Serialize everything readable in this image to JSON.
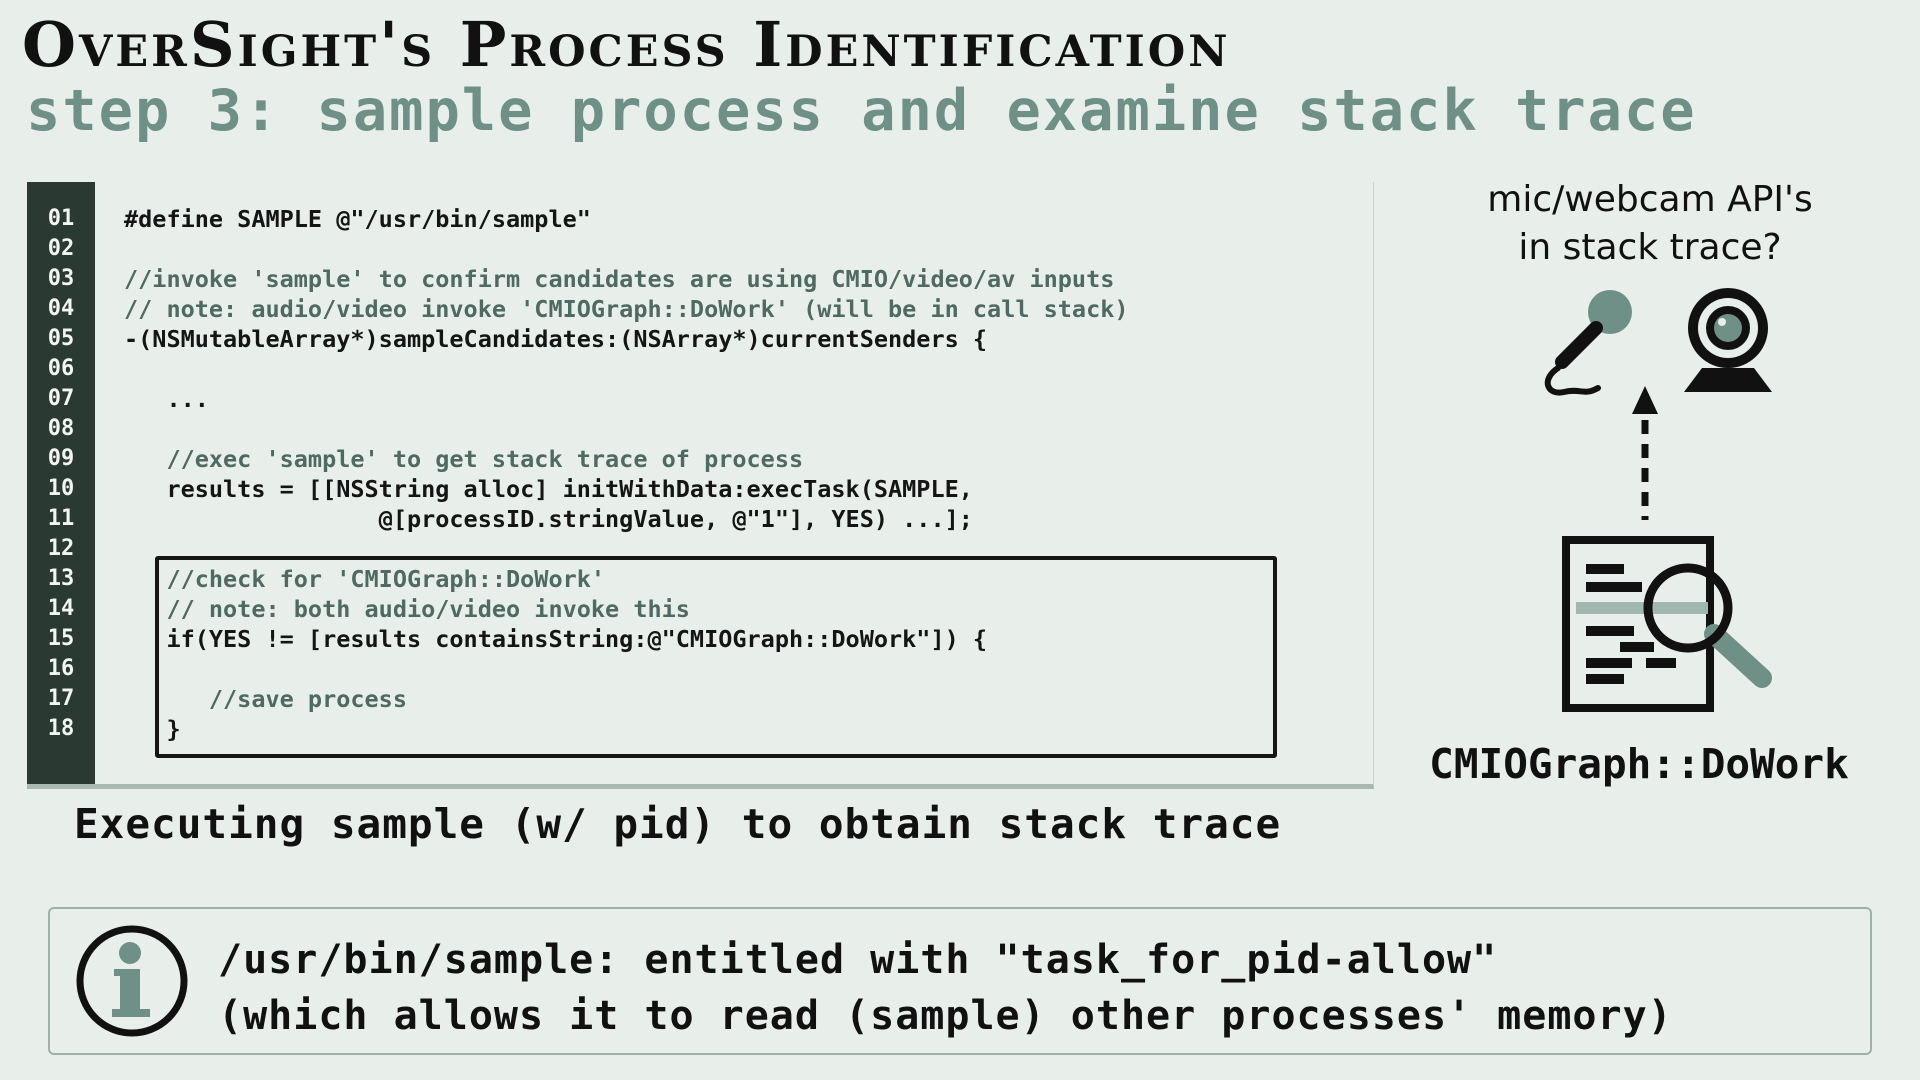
{
  "header": {
    "title": "OverSight's Process Identification",
    "subtitle": "step 3: sample process and examine stack trace"
  },
  "code": {
    "lines": [
      {
        "num": "01",
        "text": "#define SAMPLE @\"/usr/bin/sample\"",
        "kind": "code"
      },
      {
        "num": "02",
        "text": "",
        "kind": "code"
      },
      {
        "num": "03",
        "text": "//invoke 'sample' to confirm candidates are using CMIO/video/av inputs",
        "kind": "comment"
      },
      {
        "num": "04",
        "text": "// note: audio/video invoke 'CMIOGraph::DoWork' (will be in call stack)",
        "kind": "comment"
      },
      {
        "num": "05",
        "text": "-(NSMutableArray*)sampleCandidates:(NSArray*)currentSenders {",
        "kind": "code"
      },
      {
        "num": "06",
        "text": "",
        "kind": "code"
      },
      {
        "num": "07",
        "text": "   ...",
        "kind": "code"
      },
      {
        "num": "08",
        "text": "",
        "kind": "code"
      },
      {
        "num": "09",
        "text": "   //exec 'sample' to get stack trace of process",
        "kind": "comment"
      },
      {
        "num": "10",
        "text": "   results = [[NSString alloc] initWithData:execTask(SAMPLE,",
        "kind": "code"
      },
      {
        "num": "11",
        "text": "                  @[processID.stringValue, @\"1\"], YES) ...];",
        "kind": "code"
      },
      {
        "num": "12",
        "text": "",
        "kind": "code"
      },
      {
        "num": "13",
        "text": "   //check for 'CMIOGraph::DoWork'",
        "kind": "comment"
      },
      {
        "num": "14",
        "text": "   // note: both audio/video invoke this",
        "kind": "comment"
      },
      {
        "num": "15",
        "text": "   if(YES != [results containsString:@\"CMIOGraph::DoWork\"]) {",
        "kind": "code"
      },
      {
        "num": "16",
        "text": "",
        "kind": "code"
      },
      {
        "num": "17",
        "text": "      //save process",
        "kind": "comment"
      },
      {
        "num": "18",
        "text": "   }",
        "kind": "code"
      }
    ],
    "caption": "Executing sample (w/ pid) to obtain stack trace"
  },
  "diagram": {
    "question_line1": "mic/webcam API's",
    "question_line2": "in stack trace?",
    "label": "CMIOGraph::DoWork",
    "icons": [
      "microphone-icon",
      "webcam-icon",
      "up-arrow-icon",
      "document-search-icon"
    ]
  },
  "info": {
    "line1": "/usr/bin/sample: entitled with \"task_for_pid-allow\"",
    "line2": "(which allows it to read (sample) other processes' memory)",
    "icon": "info-icon"
  },
  "colors": {
    "background": "#e8efea",
    "accent": "#6f9086",
    "gutter": "#2a3a33",
    "comment": "#4e6a62"
  }
}
